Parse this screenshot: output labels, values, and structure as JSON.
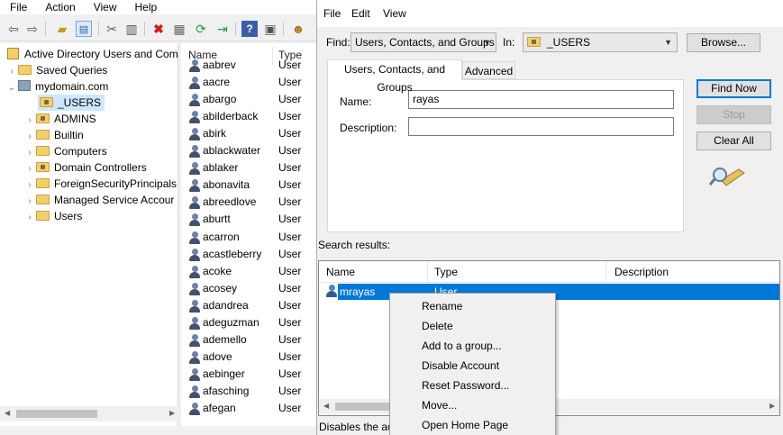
{
  "aduc": {
    "menu": [
      "File",
      "Action",
      "View",
      "Help"
    ],
    "tree": [
      {
        "label": "Active Directory Users and Com",
        "kind": "root"
      },
      {
        "label": "Saved Queries",
        "kind": "folder"
      },
      {
        "label": "mydomain.com",
        "kind": "domain"
      },
      {
        "label": "_USERS",
        "kind": "ou"
      },
      {
        "label": "ADMINS",
        "kind": "ou"
      },
      {
        "label": "Builtin",
        "kind": "folder"
      },
      {
        "label": "Computers",
        "kind": "folder"
      },
      {
        "label": "Domain Controllers",
        "kind": "ou"
      },
      {
        "label": "ForeignSecurityPrincipals",
        "kind": "folder"
      },
      {
        "label": "Managed Service Accour",
        "kind": "folder"
      },
      {
        "label": "Users",
        "kind": "folder"
      }
    ],
    "list_headers": {
      "name": "Name",
      "type": "Type"
    },
    "users": [
      {
        "name": "aabrev",
        "type": "User"
      },
      {
        "name": "aacre",
        "type": "User"
      },
      {
        "name": "abargo",
        "type": "User"
      },
      {
        "name": "abilderback",
        "type": "User"
      },
      {
        "name": "abirk",
        "type": "User"
      },
      {
        "name": "ablackwater",
        "type": "User"
      },
      {
        "name": "ablaker",
        "type": "User"
      },
      {
        "name": "abonavita",
        "type": "User"
      },
      {
        "name": "abreedlove",
        "type": "User"
      },
      {
        "name": "aburtt",
        "type": "User"
      },
      {
        "name": "acarron",
        "type": "User"
      },
      {
        "name": "acastleberry",
        "type": "User"
      },
      {
        "name": "acoke",
        "type": "User"
      },
      {
        "name": "acosey",
        "type": "User"
      },
      {
        "name": "adandrea",
        "type": "User"
      },
      {
        "name": "adeguzman",
        "type": "User"
      },
      {
        "name": "ademello",
        "type": "User"
      },
      {
        "name": "adove",
        "type": "User"
      },
      {
        "name": "aebinger",
        "type": "User"
      },
      {
        "name": "afasching",
        "type": "User"
      },
      {
        "name": "afegan",
        "type": "User"
      }
    ]
  },
  "find": {
    "menu": [
      "File",
      "Edit",
      "View"
    ],
    "find_label": "Find:",
    "find_value": "Users, Contacts, and Groups",
    "in_label": "In:",
    "in_value": "_USERS",
    "browse": "Browse...",
    "tabs": [
      "Users, Contacts, and Groups",
      "Advanced"
    ],
    "name_label": "Name:",
    "name_value": "rayas",
    "description_label": "Description:",
    "description_value": "",
    "find_now": "Find Now",
    "stop": "Stop",
    "clear_all": "Clear All",
    "results_label": "Search results:",
    "columns": [
      "Name",
      "Type",
      "Description"
    ],
    "result": {
      "name": "mrayas",
      "type": "User"
    },
    "status": "Disables the acc"
  },
  "context_menu": [
    "Rename",
    "Delete",
    "Add to a group...",
    "Disable Account",
    "Reset Password...",
    "Move...",
    "Open Home Page"
  ],
  "colors": {
    "selection": "#0078d7",
    "default_button": "#0078d7",
    "tree_selection": "#cce8ff"
  }
}
